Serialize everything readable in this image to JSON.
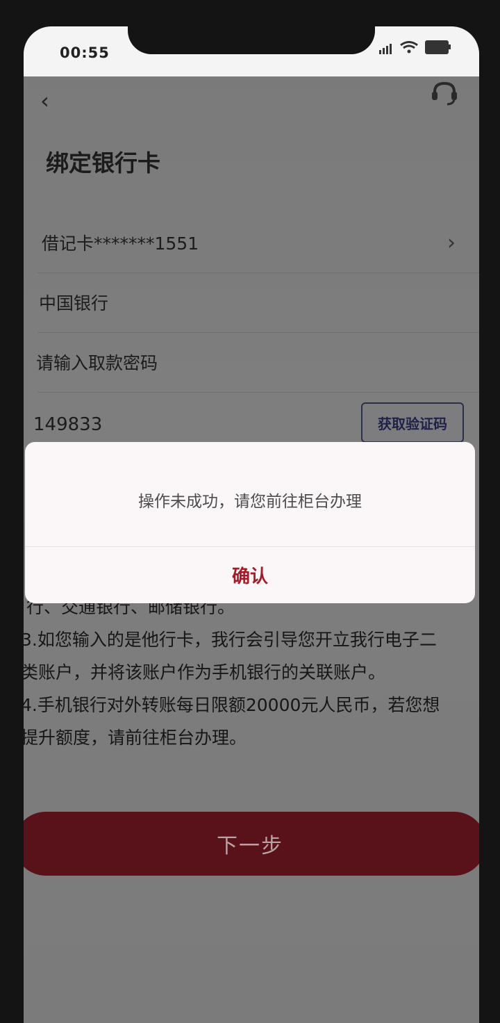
{
  "status": {
    "time": "00:55"
  },
  "header": {
    "title": "绑定银行卡"
  },
  "form": {
    "card": "借记卡*******1551",
    "bank": "中国银行",
    "password_placeholder": "请输入取款密码",
    "sms_code": "149833",
    "get_code_label": "获取验证码"
  },
  "notes": [
    "行、交通银行、邮储银行。",
    "3.如您输入的是他行卡，我行会引导您开立我行电子二",
    "类账户，并将该账户作为手机银行的关联账户。",
    "4.手机银行对外转账每日限额20000元人民币，若您想",
    "提升额度，请前往柜台办理。"
  ],
  "next_label": "下一步",
  "dialog": {
    "message": "操作未成功，请您前往柜台办理",
    "confirm": "确认"
  },
  "colors": {
    "accent": "#a11d2b",
    "button": "#5a121a"
  }
}
